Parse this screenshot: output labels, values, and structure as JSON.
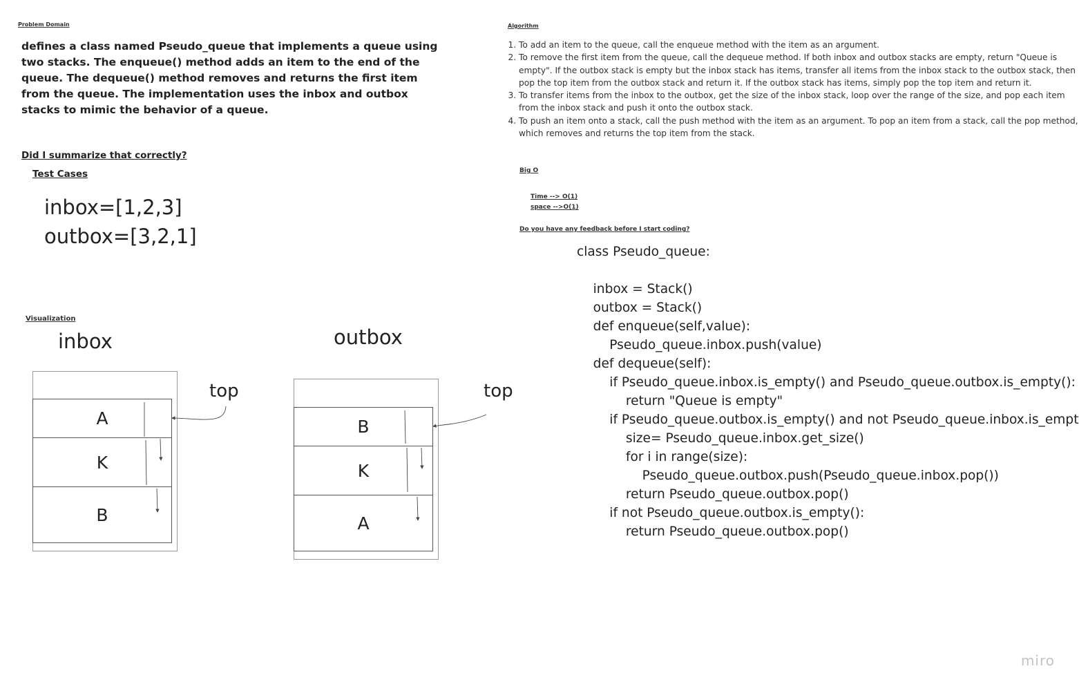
{
  "problem_domain": {
    "heading": "Problem Domain",
    "summary": "defines a class named Pseudo_queue that implements a queue using two stacks. The enqueue() method adds an item to the end of the queue. The dequeue() method removes and returns the first item from the queue. The implementation uses the inbox and outbox stacks to mimic the behavior of a queue.",
    "question": "Did I summarize that correctly?"
  },
  "test_cases": {
    "heading": "Test Cases",
    "lines": [
      "inbox=[1,2,3]",
      "outbox=[3,2,1]"
    ]
  },
  "visualization": {
    "heading": "Visualization",
    "inbox": {
      "label": "inbox",
      "top_label": "top",
      "items": [
        "A",
        "K",
        "B"
      ]
    },
    "outbox": {
      "label": "outbox",
      "top_label": "top",
      "items": [
        "B",
        "K",
        "A"
      ]
    }
  },
  "algorithm": {
    "heading": "Algorithm",
    "steps": [
      "To add an item to the queue, call the enqueue method with the item as an argument.",
      "To remove the first item from the queue, call the dequeue method. If both inbox and outbox stacks are empty, return \"Queue is empty\". If the outbox stack is empty but the inbox stack has items, transfer all items from the inbox stack to the outbox stack, then pop the top item from the outbox stack and return it. If the outbox stack has items, simply pop the top item and return it.",
      "To transfer items from the inbox to the outbox, get the size of the inbox stack, loop over the range of the size, and pop each item from the inbox stack and push it onto the outbox stack.",
      "To push an item onto a stack, call the push method with the item as an argument. To pop an item from a stack, call the pop method, which removes and returns the top item from the stack."
    ]
  },
  "big_o": {
    "heading": "Big O",
    "time": "Time --> O(1)",
    "space": "space -->O(1)"
  },
  "feedback_question": "Do you have any feedback before I start coding?",
  "code": {
    "lines": [
      "class Pseudo_queue:",
      "",
      "    inbox = Stack()",
      "    outbox = Stack()",
      "    def enqueue(self,value):",
      "        Pseudo_queue.inbox.push(value)",
      "    def dequeue(self):",
      "        if Pseudo_queue.inbox.is_empty() and Pseudo_queue.outbox.is_empty():",
      "            return \"Queue is empty\"",
      "        if Pseudo_queue.outbox.is_empty() and not Pseudo_queue.inbox.is_empty():",
      "            size= Pseudo_queue.inbox.get_size()",
      "            for i in range(size):",
      "                Pseudo_queue.outbox.push(Pseudo_queue.inbox.pop())",
      "            return Pseudo_queue.outbox.pop()",
      "        if not Pseudo_queue.outbox.is_empty():",
      "            return Pseudo_queue.outbox.pop()"
    ]
  },
  "watermark": "miro"
}
